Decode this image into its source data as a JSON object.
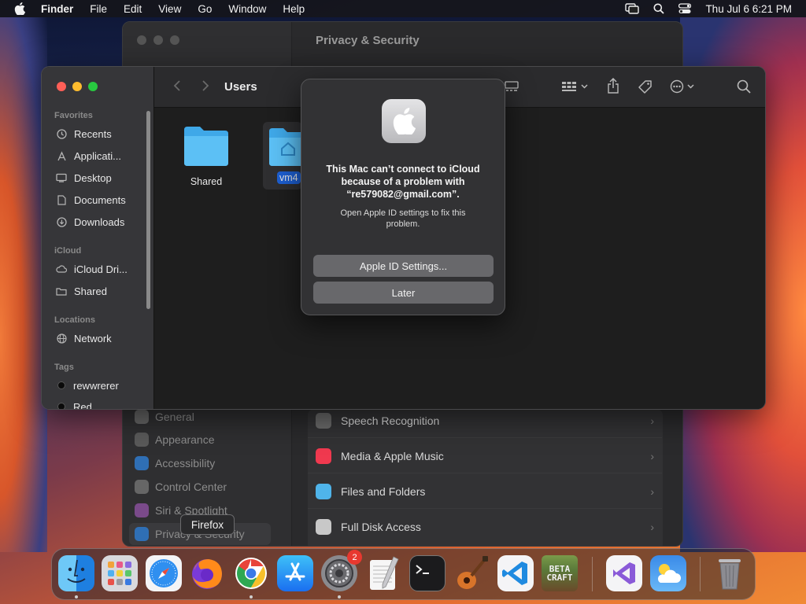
{
  "menubar": {
    "app": "Finder",
    "items": [
      "File",
      "Edit",
      "View",
      "Go",
      "Window",
      "Help"
    ],
    "clock": "Thu Jul 6  6:21 PM"
  },
  "settings": {
    "title": "Privacy & Security",
    "sidebar": [
      "General",
      "Appearance",
      "Accessibility",
      "Control Center",
      "Siri & Spotlight",
      "Privacy & Security"
    ],
    "rows": [
      "Speech Recognition",
      "Media & Apple Music",
      "Files and Folders",
      "Full Disk Access"
    ]
  },
  "finder": {
    "title": "Users",
    "sections": {
      "favorites": "Favorites",
      "icloud": "iCloud",
      "locations": "Locations",
      "tags": "Tags"
    },
    "favorites": [
      "Recents",
      "Applicati...",
      "Desktop",
      "Documents",
      "Downloads"
    ],
    "icloud": [
      "iCloud Dri...",
      "Shared"
    ],
    "locations": [
      "Network"
    ],
    "tags": [
      "rewwrerer",
      "Red"
    ],
    "items": [
      {
        "label": "Shared"
      },
      {
        "label": "vm4"
      }
    ]
  },
  "dialog": {
    "message": "This Mac can’t connect to iCloud because of a problem with “re579082@gmail.com”.",
    "info": "Open Apple ID settings to fix this problem.",
    "primary_button": "Apple ID Settings...",
    "secondary_button": "Later"
  },
  "dock": {
    "tooltip": "Firefox",
    "settings_badge": "2",
    "apps": [
      "Finder",
      "Launchpad",
      "Safari",
      "Firefox",
      "Chrome",
      "App Store",
      "System Settings",
      "TextEdit",
      "Terminal",
      "GarageBand",
      "VS Code",
      "Beta Craft",
      "Visual Studio",
      "Weather",
      "Trash"
    ],
    "betacraft_label_1": "BETA",
    "betacraft_label_2": "CRAFT"
  },
  "colors": {
    "accent": "#1d5fd1",
    "close": "#ff5f57",
    "minimize": "#febc2e",
    "zoom": "#28c840",
    "badge": "#e8382f"
  }
}
